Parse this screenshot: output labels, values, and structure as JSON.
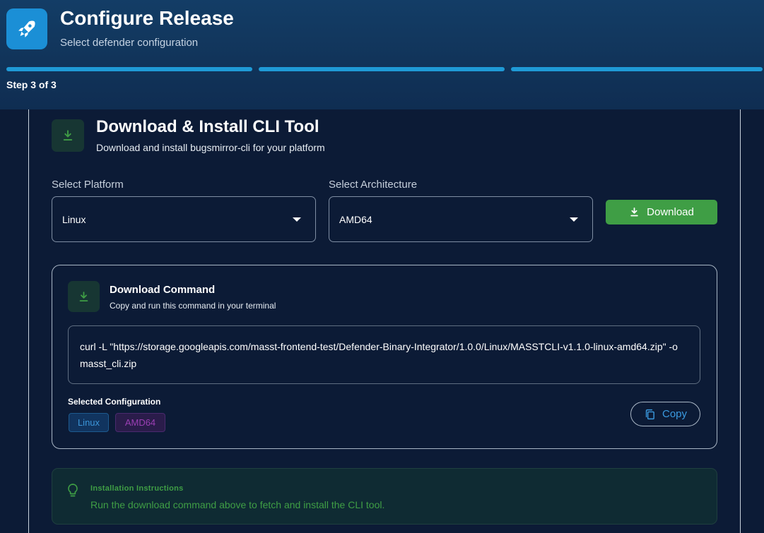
{
  "header": {
    "title": "Configure Release",
    "subtitle": "Select defender configuration",
    "step_text": "Step 3 of 3",
    "step_total": 3,
    "step_current": 3
  },
  "section": {
    "title": "Download & Install CLI Tool",
    "subtitle": "Download and install bugsmirror-cli for your platform"
  },
  "platform": {
    "label": "Select Platform",
    "value": "Linux"
  },
  "architecture": {
    "label": "Select Architecture",
    "value": "AMD64"
  },
  "download_button": {
    "label": "Download"
  },
  "command": {
    "title": "Download Command",
    "subtitle": "Copy and run this command in your terminal",
    "text": "curl -L \"https://storage.googleapis.com/masst-frontend-test/Defender-Binary-Integrator/1.0.0/Linux/MASSTCLI-v1.1.0-linux-amd64.zip\" -o masst_cli.zip",
    "selected_label": "Selected Configuration",
    "chips": [
      "Linux",
      "AMD64"
    ],
    "copy_label": "Copy"
  },
  "install": {
    "title": "Installation Instructions",
    "text": "Run the download command above to fetch and install the CLI tool."
  },
  "colors": {
    "accent": "#1f9ad6",
    "success": "#3f9e45",
    "background": "#0c1b36"
  }
}
